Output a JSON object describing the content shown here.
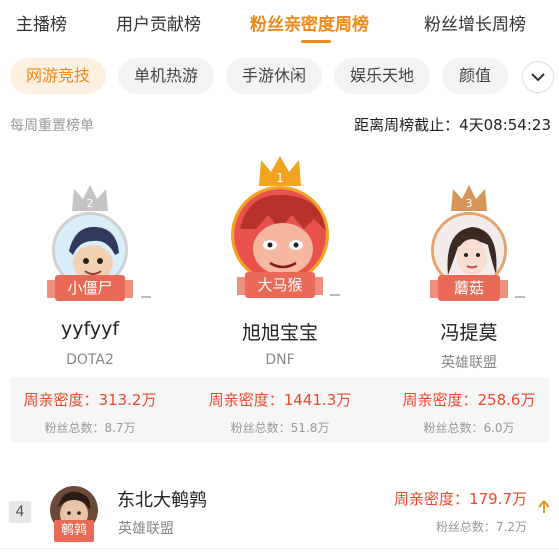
{
  "tabs": [
    {
      "label": "主播榜"
    },
    {
      "label": "用户贡献榜"
    },
    {
      "label": "粉丝亲密度周榜"
    },
    {
      "label": "粉丝增长周榜"
    }
  ],
  "categories": [
    {
      "label": "网游竞技"
    },
    {
      "label": "单机热游"
    },
    {
      "label": "手游休闲"
    },
    {
      "label": "娱乐天地"
    },
    {
      "label": "颜值"
    }
  ],
  "info": {
    "reset_text": "每周重置榜单",
    "countdown": "距离周榜截止：4天08:54:23"
  },
  "podium": [
    {
      "rank": "2",
      "banner": "小僵尸",
      "name": "yyfyyf",
      "game": "DOTA2",
      "intimacy": "周亲密度：313.2万",
      "fans": "粉丝总数：8.7万"
    },
    {
      "rank": "1",
      "banner": "大马猴",
      "name": "旭旭宝宝",
      "game": "DNF",
      "intimacy": "周亲密度：1441.3万",
      "fans": "粉丝总数：51.8万"
    },
    {
      "rank": "3",
      "banner": "蘑菇",
      "name": "冯提莫",
      "game": "英雄联盟",
      "intimacy": "周亲密度：258.6万",
      "fans": "粉丝总数：6.0万"
    }
  ],
  "list": [
    {
      "rank": "4",
      "banner": "鹌鹑",
      "name": "东北大鹌鹑",
      "game": "英雄联盟",
      "intimacy": "周亲密度：179.7万",
      "fans": "粉丝总数：7.2万",
      "trend": "up-arrow-icon"
    }
  ],
  "colors": {
    "accent": "#f08a1c",
    "stat_red": "#e84a2e",
    "gold": "#f2a31f",
    "silver": "#c4c4c4",
    "bronze": "#d8955a"
  }
}
